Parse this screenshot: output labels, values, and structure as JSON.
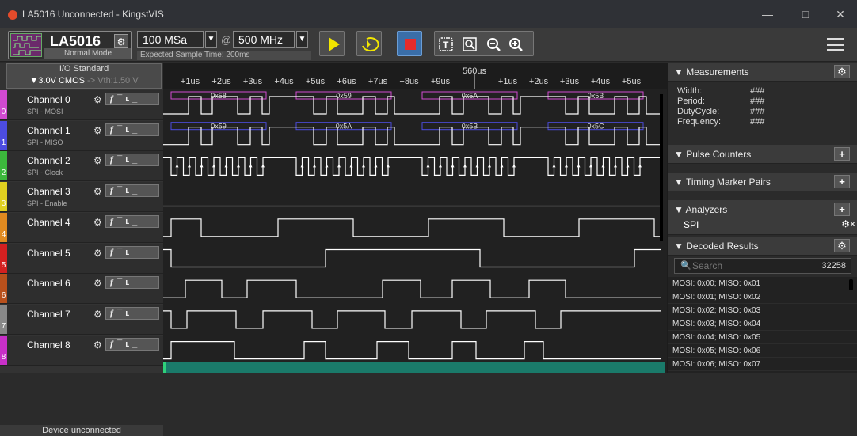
{
  "window": {
    "title": "LA5016 Unconnected - KingstVIS"
  },
  "toolbar": {
    "device_name": "LA5016",
    "device_mode": "Normal Mode",
    "sample_rate": "100 MSa",
    "at_symbol": "@",
    "clock": "500 MHz",
    "expected_time": "Expected Sample Time: 200ms"
  },
  "io": {
    "title": "I/O Standard",
    "value": "▼3.0V CMOS",
    "arrow": "->",
    "vth": "Vth:1.50 V"
  },
  "channels": [
    {
      "num": "0",
      "name": "Channel 0",
      "sub": "SPI - MOSI",
      "color": "#d14ad1"
    },
    {
      "num": "1",
      "name": "Channel 1",
      "sub": "SPI - MISO",
      "color": "#4c4ce0"
    },
    {
      "num": "2",
      "name": "Channel 2",
      "sub": "SPI - Clock",
      "color": "#3cb83c"
    },
    {
      "num": "3",
      "name": "Channel 3",
      "sub": "SPI - Enable",
      "color": "#e0d020"
    },
    {
      "num": "4",
      "name": "Channel 4",
      "sub": "",
      "color": "#e08a20"
    },
    {
      "num": "5",
      "name": "Channel 5",
      "sub": "",
      "color": "#d42020"
    },
    {
      "num": "6",
      "name": "Channel 6",
      "sub": "",
      "color": "#b8501c"
    },
    {
      "num": "7",
      "name": "Channel 7",
      "sub": "",
      "color": "#888888"
    },
    {
      "num": "8",
      "name": "Channel 8",
      "sub": "",
      "color": "#c830c8"
    }
  ],
  "trigger_glyphs": "ƒ¯ʟ_",
  "device_status": "Device unconnected",
  "timeline": {
    "left_ticks": [
      "+1us",
      "+2us",
      "+3us",
      "+4us",
      "+5us",
      "+6us",
      "+7us",
      "+8us",
      "+9us"
    ],
    "center": "560us",
    "right_ticks": [
      "+1us",
      "+2us",
      "+3us",
      "+4us",
      "+5us"
    ]
  },
  "decode": {
    "ch0": [
      "0x58",
      "0x59",
      "0x5A",
      "0x5B"
    ],
    "ch1": [
      "0x59",
      "0x5A",
      "0x5B",
      "0x5C"
    ]
  },
  "measurements": {
    "title": "▼ Measurements",
    "rows": [
      {
        "label": "Width:",
        "value": "###"
      },
      {
        "label": "Period:",
        "value": "###"
      },
      {
        "label": "DutyCycle:",
        "value": "###"
      },
      {
        "label": "Frequency:",
        "value": "###"
      }
    ]
  },
  "pulse_counters": {
    "title": "▼ Pulse Counters"
  },
  "timing_markers": {
    "title": "▼ Timing Marker Pairs"
  },
  "analyzers": {
    "title": "▼ Analyzers",
    "item": "SPI"
  },
  "decoded": {
    "title": "▼ Decoded Results",
    "search_placeholder": "Search",
    "count": "32258",
    "rows": [
      "MOSI: 0x00;  MISO: 0x01",
      "MOSI: 0x01;  MISO: 0x02",
      "MOSI: 0x02;  MISO: 0x03",
      "MOSI: 0x03;  MISO: 0x04",
      "MOSI: 0x04;  MISO: 0x05",
      "MOSI: 0x05;  MISO: 0x06",
      "MOSI: 0x06;  MISO: 0x07"
    ]
  }
}
